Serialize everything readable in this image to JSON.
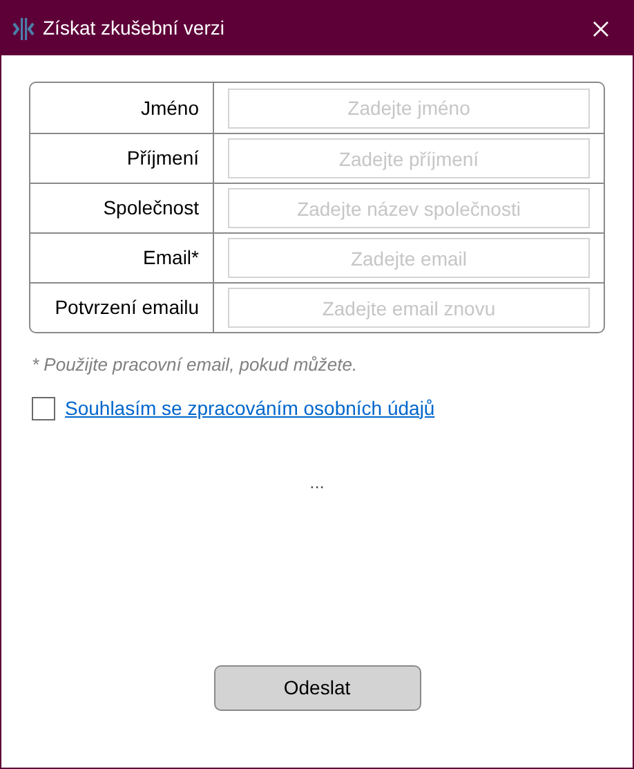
{
  "window": {
    "title": "Získat zkušební verzi"
  },
  "fields": [
    {
      "label": "Jméno",
      "placeholder": "Zadejte jméno"
    },
    {
      "label": "Příjmení",
      "placeholder": "Zadejte příjmení"
    },
    {
      "label": "Společnost",
      "placeholder": "Zadejte název společnosti"
    },
    {
      "label": "Email*",
      "placeholder": "Zadejte email"
    },
    {
      "label": "Potvrzení emailu",
      "placeholder": "Zadejte email znovu"
    }
  ],
  "note": "* Použijte pracovní email, pokud můžete.",
  "consent": {
    "checked": false,
    "label": "Souhlasím se zpracováním osobních údajů"
  },
  "status": "...",
  "submit": "Odeslat"
}
